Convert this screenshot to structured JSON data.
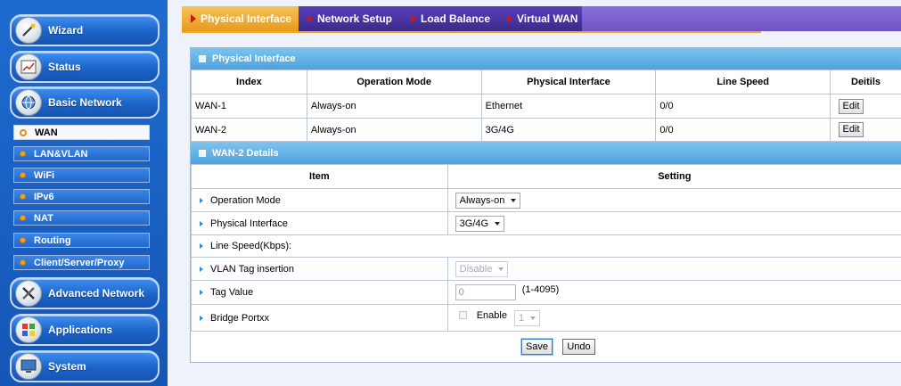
{
  "sidebar": {
    "main": [
      {
        "label": "Wizard",
        "icon": "wand-icon"
      },
      {
        "label": "Status",
        "icon": "chart-icon"
      },
      {
        "label": "Basic Network",
        "icon": "globe-icon"
      },
      {
        "label": "Advanced Network",
        "icon": "tools-icon"
      },
      {
        "label": "Applications",
        "icon": "apps-icon"
      },
      {
        "label": "System",
        "icon": "monitor-icon"
      }
    ],
    "sub": [
      {
        "label": "WAN",
        "active": true
      },
      {
        "label": "LAN&VLAN"
      },
      {
        "label": "WiFi"
      },
      {
        "label": "IPv6"
      },
      {
        "label": "NAT"
      },
      {
        "label": "Routing"
      },
      {
        "label": "Client/Server/Proxy"
      }
    ]
  },
  "tabs": [
    {
      "label": "Physical Interface",
      "active": true
    },
    {
      "label": "Network Setup"
    },
    {
      "label": "Load Balance"
    },
    {
      "label": "Virtual WAN"
    }
  ],
  "physical": {
    "title": "Physical Interface",
    "headers": [
      "Index",
      "Operation Mode",
      "Physical Interface",
      "Line Speed",
      "Deitils"
    ],
    "rows": [
      {
        "index": "WAN-1",
        "mode": "Always-on",
        "iface": "Ethernet",
        "speed": "0/0",
        "action": "Edit"
      },
      {
        "index": "WAN-2",
        "mode": "Always-on",
        "iface": "3G/4G",
        "speed": "0/0",
        "action": "Edit"
      }
    ]
  },
  "details": {
    "title": "WAN-2 Details",
    "headers": [
      "Item",
      "Setting"
    ],
    "op_mode": {
      "label": "Operation Mode",
      "value": "Always-on"
    },
    "phys_iface": {
      "label": "Physical Interface",
      "value": "3G/4G"
    },
    "line_speed": {
      "label": "Line Speed(Kbps):"
    },
    "vlan_tag": {
      "label": "VLAN Tag insertion",
      "value": "Disable"
    },
    "tag_value": {
      "label": "Tag Value",
      "value": "0",
      "range": "(1-4095)"
    },
    "bridge": {
      "label": "Bridge Portxx",
      "enable_label": "Enable",
      "port": "1"
    }
  },
  "buttons": {
    "save": "Save",
    "undo": "Undo"
  },
  "colors": {
    "sidebar_bg": "#1a62c4",
    "tab_bar": "#3b2a8d",
    "tab_active": "#e89a1a",
    "section_header": "#4ea2df",
    "arrow": "#d01515"
  }
}
